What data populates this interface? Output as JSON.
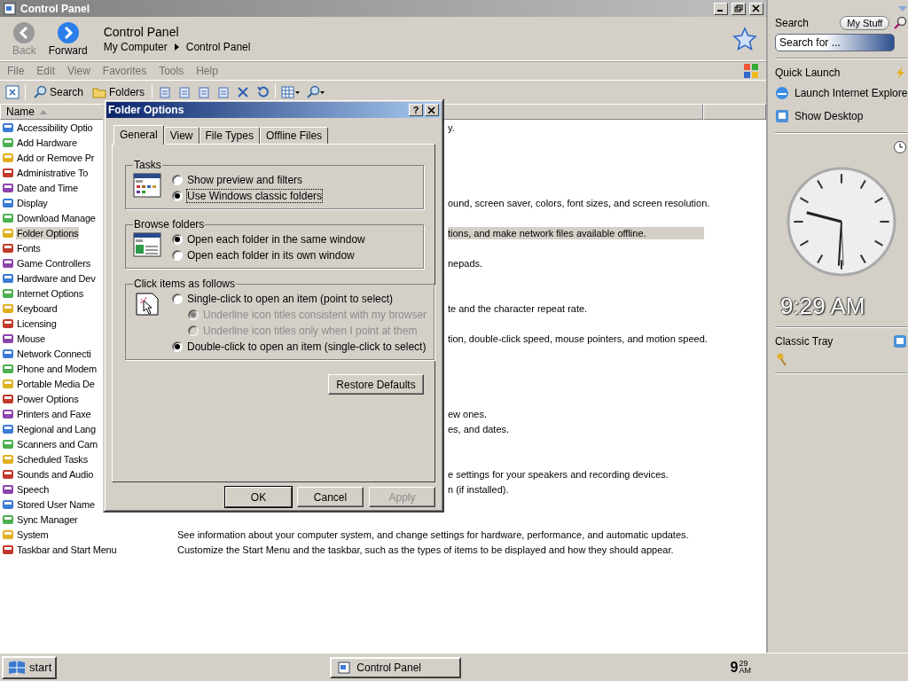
{
  "window": {
    "title": "Control Panel"
  },
  "nav": {
    "back": "Back",
    "forward": "Forward",
    "location": "Control Panel",
    "breadcrumb": [
      "My Computer",
      "Control Panel"
    ]
  },
  "menu": [
    "File",
    "Edit",
    "View",
    "Favorites",
    "Tools",
    "Help"
  ],
  "toolbar": {
    "search": "Search",
    "folders": "Folders"
  },
  "list": {
    "columns": [
      "Name"
    ],
    "rows": [
      {
        "name": "Accessibility Optio",
        "selected": false,
        "kind": "fragment",
        "description": "y."
      },
      {
        "name": "Add Hardware",
        "selected": false
      },
      {
        "name": "Add or Remove Pr",
        "selected": false
      },
      {
        "name": "Administrative To",
        "selected": false
      },
      {
        "name": "Date and Time",
        "selected": false
      },
      {
        "name": "Display",
        "selected": false,
        "kind": "fragment",
        "description": "ound, screen saver, colors, font sizes, and screen resolution."
      },
      {
        "name": "Download Manage",
        "selected": false
      },
      {
        "name": "Folder Options",
        "selected": true,
        "kind": "fragment",
        "description": "tions, and make network files available offline."
      },
      {
        "name": "Fonts",
        "selected": false
      },
      {
        "name": "Game Controllers",
        "selected": false,
        "kind": "fragment",
        "description": "nepads."
      },
      {
        "name": "Hardware and Dev",
        "selected": false
      },
      {
        "name": "Internet Options",
        "selected": false
      },
      {
        "name": "Keyboard",
        "selected": false,
        "kind": "fragment",
        "description": "te and the character repeat rate."
      },
      {
        "name": "Licensing",
        "selected": false
      },
      {
        "name": "Mouse",
        "selected": false,
        "kind": "fragment",
        "description": "tion, double-click speed, mouse pointers, and motion speed."
      },
      {
        "name": "Network Connecti",
        "selected": false
      },
      {
        "name": "Phone and Modem",
        "selected": false
      },
      {
        "name": "Portable Media De",
        "selected": false
      },
      {
        "name": "Power Options",
        "selected": false
      },
      {
        "name": "Printers and Faxe",
        "selected": false,
        "kind": "fragment",
        "description": "ew ones."
      },
      {
        "name": "Regional and Lang",
        "selected": false,
        "kind": "fragment",
        "description": "es, and dates."
      },
      {
        "name": "Scanners and Cam",
        "selected": false
      },
      {
        "name": "Scheduled Tasks",
        "selected": false
      },
      {
        "name": "Sounds and Audio",
        "selected": false,
        "kind": "fragment",
        "description": "e settings for your speakers and recording devices."
      },
      {
        "name": "Speech",
        "selected": false,
        "kind": "fragment",
        "description": "n (if installed)."
      },
      {
        "name": "Stored User Name",
        "selected": false
      },
      {
        "name": "Sync Manager",
        "selected": false
      },
      {
        "name": "System",
        "selected": false,
        "kind": "full",
        "description": "See information about your computer system, and change settings for hardware, performance, and automatic updates."
      },
      {
        "name": "Taskbar and Start Menu",
        "selected": false,
        "kind": "full",
        "description": "Customize the Start Menu and the taskbar, such as the types of items to be displayed and how they should appear."
      }
    ]
  },
  "dialog": {
    "title": "Folder Options",
    "help": "?",
    "tabs": [
      {
        "label": "General",
        "selected": true
      },
      {
        "label": "View",
        "selected": false
      },
      {
        "label": "File Types",
        "selected": false
      },
      {
        "label": "Offline Files",
        "selected": false
      }
    ],
    "groups": [
      {
        "title": "Tasks",
        "kind": "tasks",
        "options": [
          {
            "label": "Show preview and filters",
            "selected": false,
            "disabled": false,
            "focused": false
          },
          {
            "label": "Use Windows classic folders",
            "selected": true,
            "disabled": false,
            "focused": true
          }
        ]
      },
      {
        "title": "Browse folders",
        "kind": "browse",
        "options": [
          {
            "label": "Open each folder in the same window",
            "selected": true,
            "disabled": false,
            "focused": false
          },
          {
            "label": "Open each folder in its own window",
            "selected": false,
            "disabled": false,
            "focused": false
          }
        ]
      },
      {
        "title": "Click items as follows",
        "kind": "click",
        "options": [
          {
            "label": "Single-click to open an item (point to select)",
            "selected": false,
            "disabled": false,
            "focused": false,
            "children": [
              {
                "label": "Underline icon titles consistent with my browser",
                "selected": true,
                "disabled": true,
                "focused": false
              },
              {
                "label": "Underline icon titles only when I point at them",
                "selected": false,
                "disabled": true,
                "focused": false
              }
            ]
          },
          {
            "label": "Double-click to open an item (single-click to select)",
            "selected": true,
            "disabled": false,
            "focused": false
          }
        ]
      }
    ],
    "restore": "Restore Defaults",
    "buttons": [
      {
        "label": "OK",
        "disabled": false
      },
      {
        "label": "Cancel",
        "disabled": false
      },
      {
        "label": "Apply",
        "disabled": true
      }
    ]
  },
  "sidebar": {
    "search": {
      "title": "Search",
      "scope": "My Stuff",
      "placeholder": "Search for ..."
    },
    "quick_launch": {
      "title": "Quick Launch",
      "items": [
        {
          "label": "Launch Internet Explore",
          "kind": "browser"
        },
        {
          "label": "Show Desktop",
          "kind": "desktop"
        }
      ]
    },
    "clock": {
      "time": "9:29 AM"
    },
    "tray": {
      "title": "Classic Tray"
    }
  },
  "taskbar": {
    "start": "start",
    "tasks": [
      {
        "label": "Control Panel",
        "selected": false
      }
    ],
    "clock": {
      "hour": "9",
      "minutes": "29",
      "period": "AM"
    }
  }
}
